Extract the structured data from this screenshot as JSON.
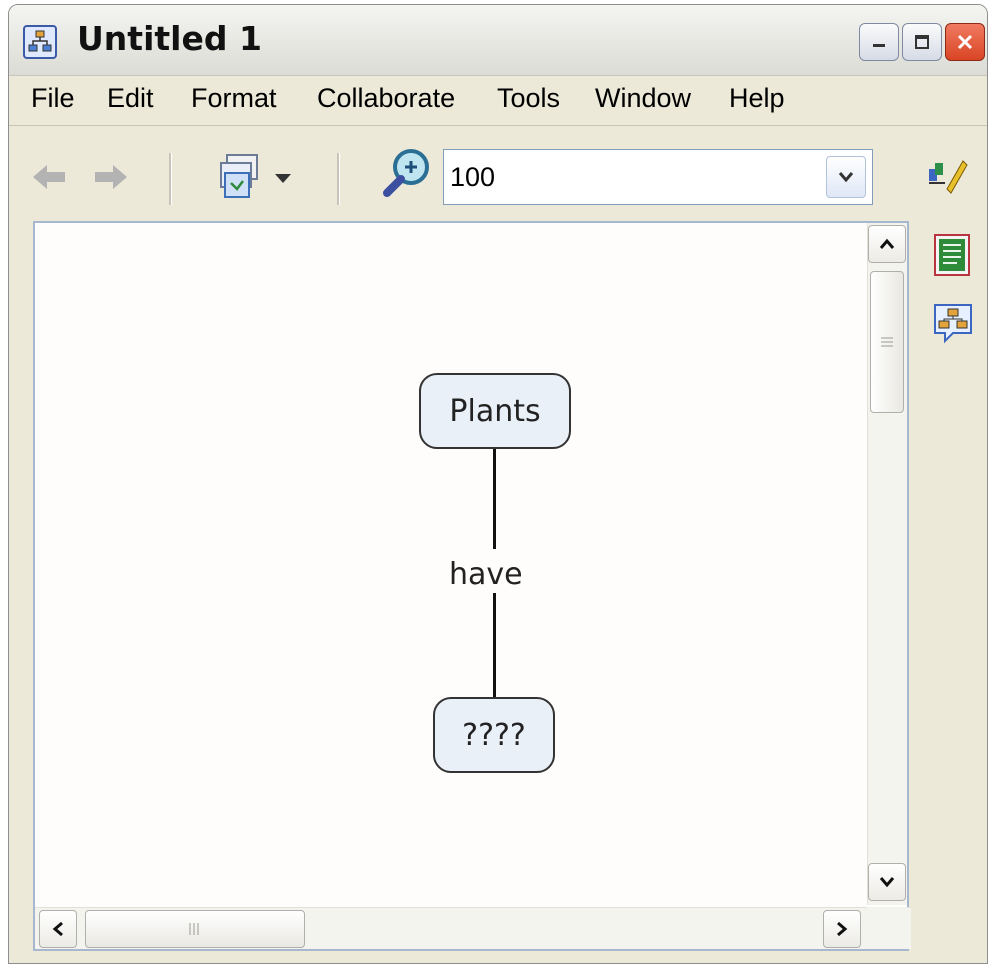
{
  "window": {
    "title": "Untitled 1",
    "icons": {
      "app": "concept-map-app-icon",
      "minimize": "minimize-icon",
      "maximize": "maximize-icon",
      "close": "close-icon"
    }
  },
  "menu": {
    "items": [
      "File",
      "Edit",
      "Format",
      "Collaborate",
      "Tools",
      "Window",
      "Help"
    ]
  },
  "toolbar": {
    "zoom_value": "100",
    "icons": [
      "back-arrow-icon",
      "forward-arrow-icon",
      "view-presentation-icon",
      "zoom-icon",
      "dropdown-arrow-icon",
      "style-palette-icon"
    ]
  },
  "side_panel": {
    "icons": [
      "notes-icon",
      "concept-map-bubble-icon"
    ]
  },
  "concept_map": {
    "nodes": [
      {
        "label": "Plants"
      },
      {
        "label": "????"
      }
    ],
    "links": [
      {
        "label": "have"
      }
    ]
  },
  "colors": {
    "window_bg": "#ece9d8",
    "canvas_bg": "#fffdfb",
    "node_fill": "#e9f0f7",
    "close_button": "#d94524"
  }
}
